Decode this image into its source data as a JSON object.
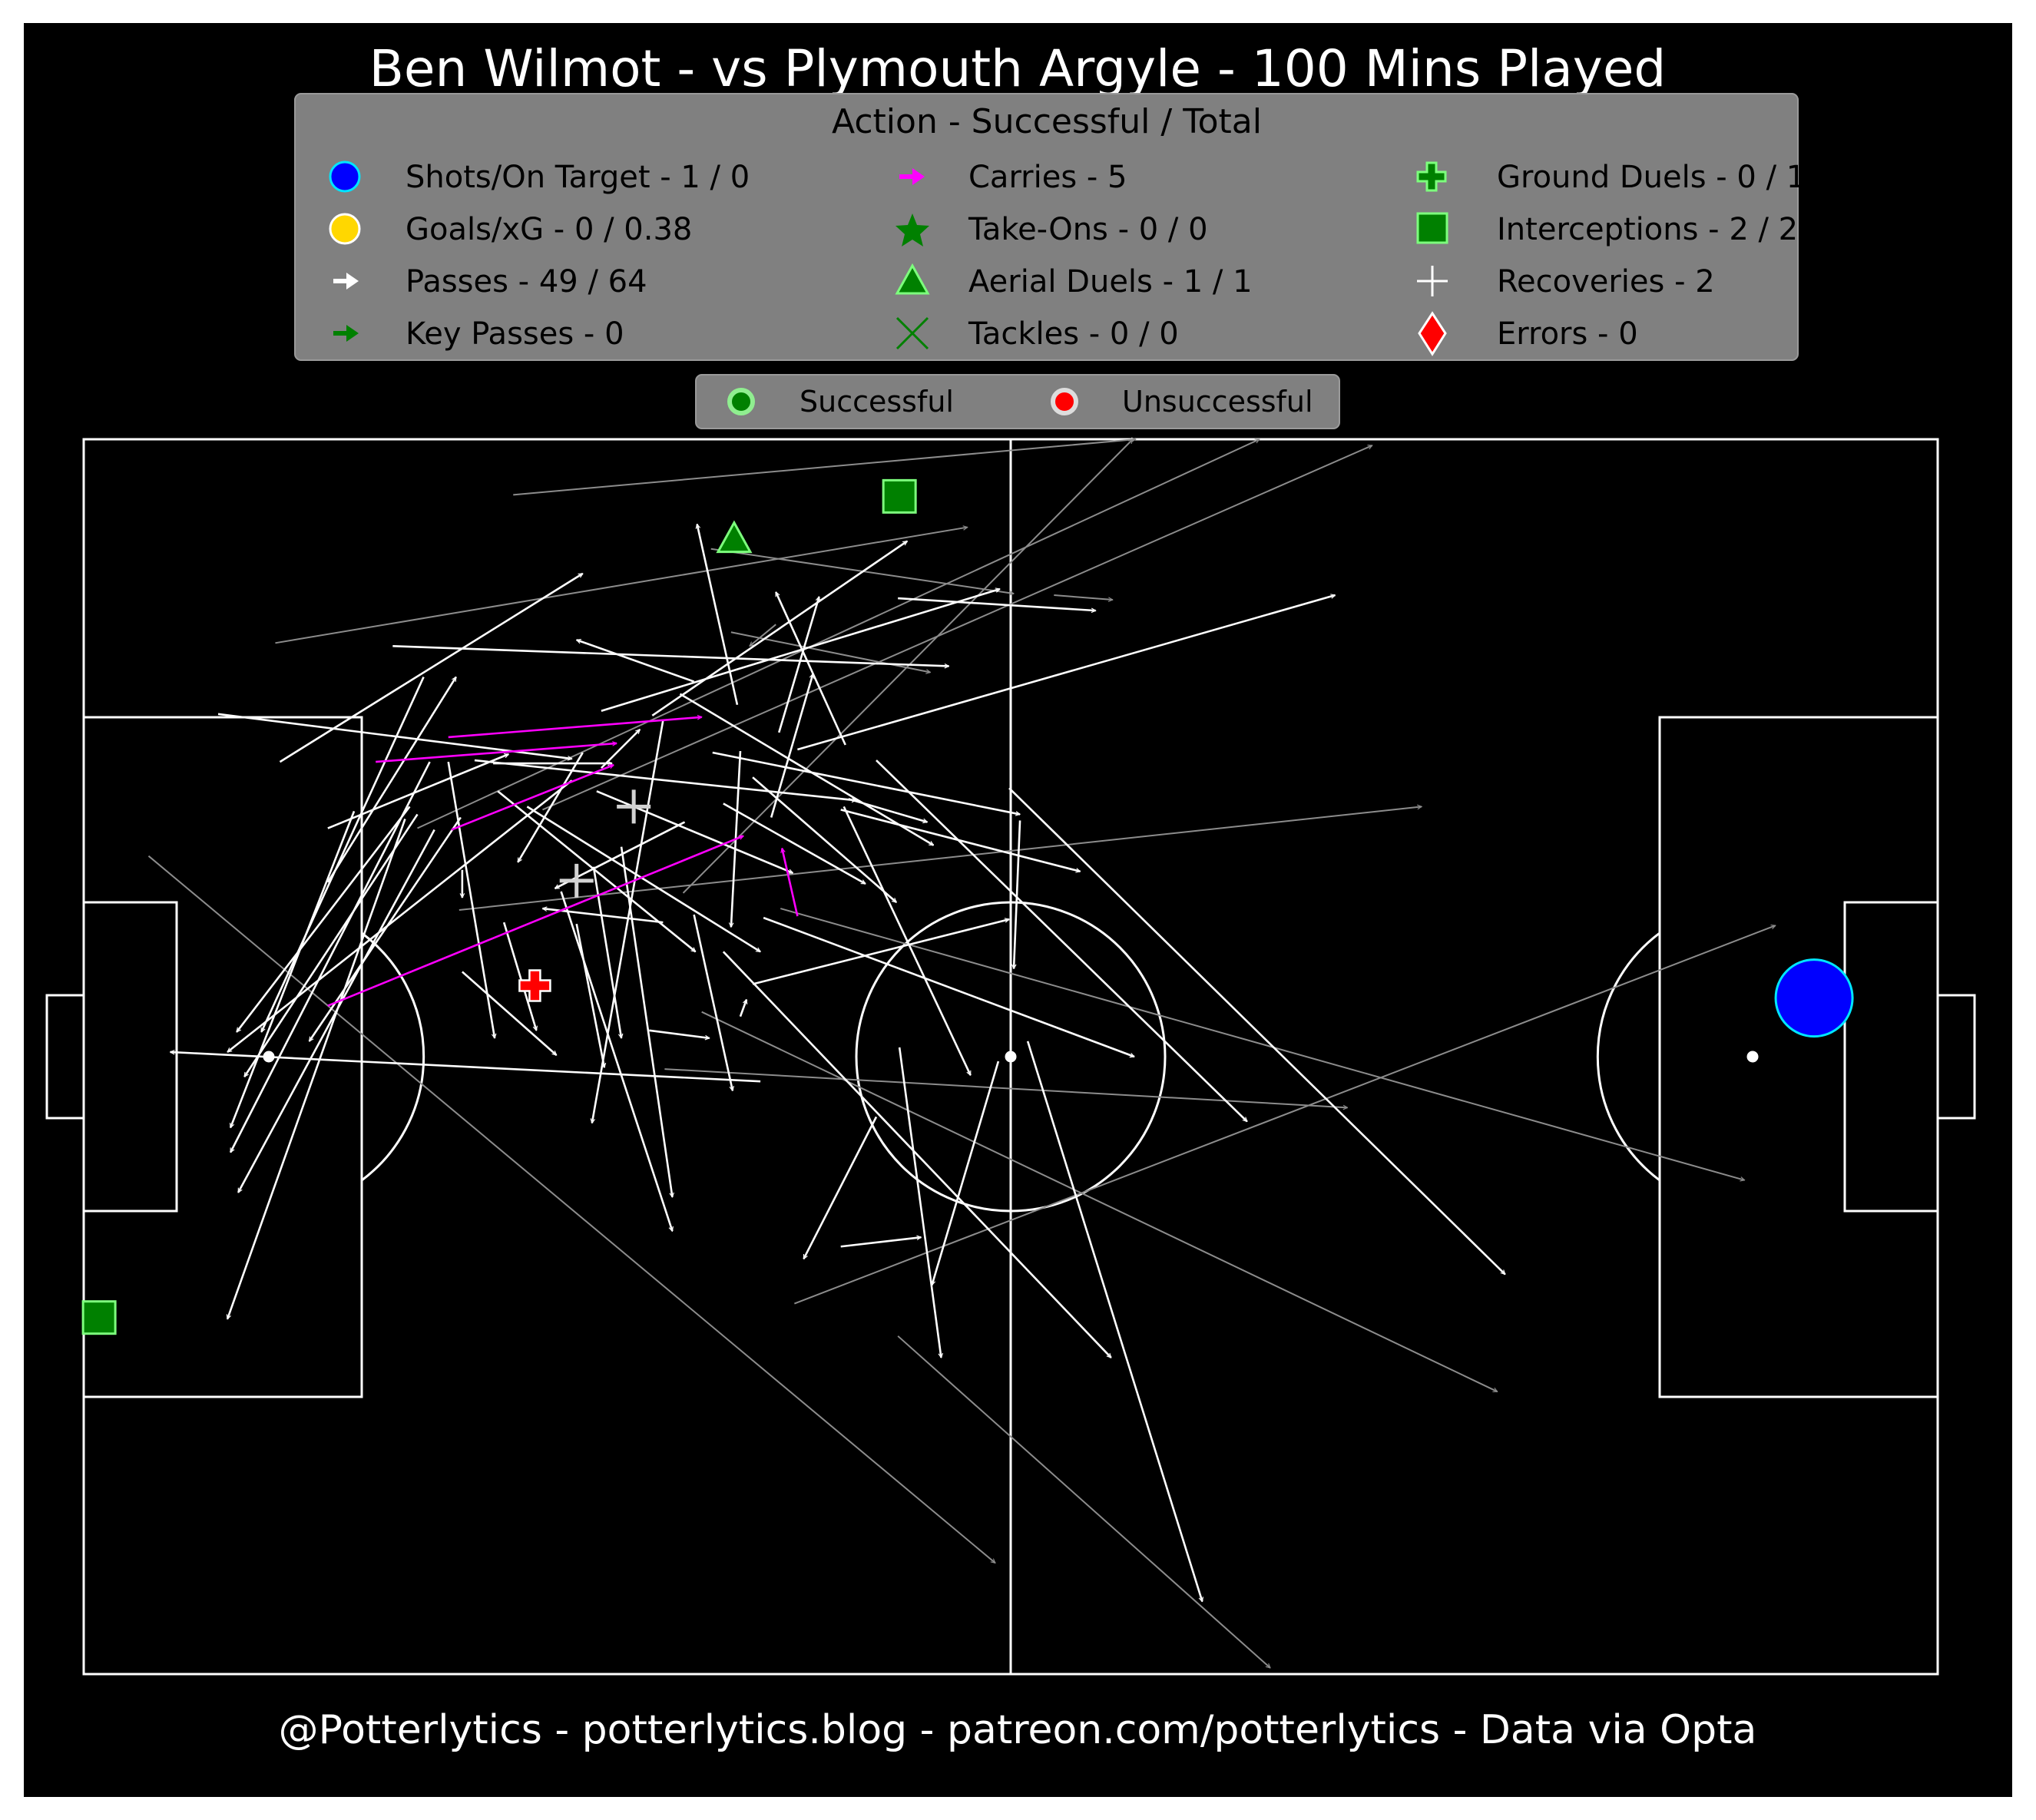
{
  "title": "Ben Wilmot - vs Plymouth Argyle - 100 Mins Played",
  "footer": "@Potterlytics - potterlytics.blog - patreon.com/potterlytics - Data via Opta",
  "legend": {
    "title": "Action - Successful / Total",
    "items": [
      {
        "label": "Shots/On Target - 1 / 0",
        "icon": "shot-marker"
      },
      {
        "label": "Goals/xG - 0 / 0.38",
        "icon": "goal-marker"
      },
      {
        "label": "Passes - 49 / 64",
        "icon": "pass-arrow"
      },
      {
        "label": "Key Passes - 0",
        "icon": "key-pass-arrow"
      },
      {
        "label": "Carries - 5",
        "icon": "carry-arrow"
      },
      {
        "label": "Take-Ons - 0 / 0",
        "icon": "take-on-star"
      },
      {
        "label": "Aerial Duels - 1 / 1",
        "icon": "aerial-triangle"
      },
      {
        "label": "Tackles - 0 / 0",
        "icon": "tackle-cross"
      },
      {
        "label": "Ground Duels - 0 / 1",
        "icon": "ground-duel-plus"
      },
      {
        "label": "Interceptions - 2 / 2",
        "icon": "interception-square"
      },
      {
        "label": "Recoveries - 2",
        "icon": "recovery-plus"
      },
      {
        "label": "Errors - 0",
        "icon": "error-diamond"
      }
    ]
  },
  "outcome_legend": {
    "successful": "Successful",
    "unsuccessful": "Unsuccessful"
  },
  "colors": {
    "background": "#000000",
    "pitch_lines": "#ffffff",
    "pass_success": "#ffffff",
    "pass_fail": "#8c8c8c",
    "carry": "#ff00ff",
    "shot": "#0000ff",
    "goal": "#ffd700",
    "key_pass": "#008000",
    "defensive": "#008000",
    "recovery": "#d3d3d3",
    "error": "#ff0000",
    "legend_bg": "#808080"
  },
  "chart_data": {
    "type": "scatter",
    "description_units": "pitch coordinates, x 0-120 (attacking left to right), y 0-80 (top touchline = 0)",
    "passes_successful": [
      [
        8.7,
        17.8,
        31.6,
        20.7
      ],
      [
        12.7,
        20.9,
        32.3,
        8.7
      ],
      [
        15.8,
        28.7,
        24.1,
        15.4
      ],
      [
        15.8,
        25.2,
        27.5,
        20.4
      ],
      [
        22.0,
        15.4,
        11.5,
        38.4
      ],
      [
        21.1,
        23.8,
        9.9,
        38.4
      ],
      [
        21.6,
        24.3,
        10.4,
        41.3
      ],
      [
        17.5,
        24.1,
        9.5,
        44.6
      ],
      [
        24.4,
        24.5,
        14.6,
        39.0
      ],
      [
        26.8,
        22.8,
        39.6,
        33.2
      ],
      [
        25.3,
        20.8,
        50.0,
        23.4
      ],
      [
        26.5,
        21.0,
        34.2,
        21.0
      ],
      [
        23.6,
        20.9,
        26.6,
        38.8
      ],
      [
        33.5,
        21.3,
        36.0,
        18.8
      ],
      [
        22.7,
        25.3,
        10.0,
        48.8
      ],
      [
        20.8,
        24.6,
        9.3,
        57.0
      ],
      [
        22.4,
        20.9,
        9.5,
        46.2
      ],
      [
        31.6,
        22.1,
        9.3,
        39.7
      ],
      [
        32.3,
        20.3,
        28.1,
        27.4
      ],
      [
        34.8,
        26.4,
        38.1,
        49.1
      ],
      [
        43.8,
        41.6,
        5.6,
        39.7
      ],
      [
        41.4,
        23.6,
        50.6,
        28.8
      ],
      [
        43.3,
        21.9,
        52.6,
        30.0
      ],
      [
        38.9,
        24.8,
        30.5,
        29.1
      ],
      [
        42.5,
        37.4,
        42.9,
        36.3
      ],
      [
        39.5,
        30.8,
        42.0,
        42.2
      ],
      [
        37.5,
        18.2,
        32.9,
        44.3
      ],
      [
        36.6,
        38.3,
        40.5,
        38.8
      ],
      [
        31.9,
        31.4,
        33.7,
        40.7
      ],
      [
        24.5,
        34.5,
        30.6,
        39.9
      ],
      [
        28.7,
        23.8,
        43.8,
        33.2
      ],
      [
        33.0,
        27.7,
        34.8,
        38.8
      ],
      [
        37.5,
        31.3,
        29.7,
        30.4
      ],
      [
        27.2,
        31.3,
        29.3,
        38.3
      ],
      [
        30.9,
        29.3,
        38.1,
        51.3
      ],
      [
        33.2,
        22.8,
        45.9,
        28.1
      ],
      [
        45.0,
        19.0,
        47.6,
        10.2
      ],
      [
        42.3,
        17.2,
        39.7,
        5.5
      ],
      [
        49.3,
        19.8,
        44.8,
        9.9
      ],
      [
        49.5,
        23.3,
        54.6,
        24.8
      ],
      [
        44.5,
        24.5,
        47.2,
        15.2
      ],
      [
        42.5,
        20.2,
        41.9,
        31.6
      ],
      [
        49.0,
        24.0,
        64.5,
        28.0
      ],
      [
        51.3,
        43.9,
        46.6,
        53.1
      ],
      [
        52.8,
        39.4,
        55.5,
        59.5
      ],
      [
        49.2,
        23.8,
        57.4,
        41.2
      ],
      [
        51.3,
        20.8,
        75.3,
        44.2
      ],
      [
        59.2,
        40.3,
        54.9,
        54.8
      ],
      [
        61.1,
        39.0,
        72.4,
        75.3
      ],
      [
        38.6,
        16.5,
        55.0,
        26.3
      ],
      [
        59.9,
        22.6,
        92.0,
        54.1
      ],
      [
        43.3,
        35.3,
        59.9,
        31.1
      ],
      [
        36.8,
        17.9,
        53.3,
        6.6
      ],
      [
        46.2,
        20.1,
        81.0,
        10.1
      ],
      [
        33.5,
        17.6,
        59.3,
        9.7
      ],
      [
        41.4,
        33.2,
        66.5,
        59.5
      ],
      [
        52.7,
        10.3,
        65.5,
        11.1
      ],
      [
        39.5,
        15.7,
        31.9,
        13.0
      ],
      [
        20.0,
        13.4,
        56.0,
        14.7
      ],
      [
        24.5,
        27.9,
        24.5,
        29.7
      ],
      [
        49.0,
        52.3,
        54.2,
        51.7
      ],
      [
        60.6,
        24.7,
        60.2,
        34.3
      ],
      [
        40.7,
        20.3,
        60.6,
        24.3
      ],
      [
        44.0,
        31.0,
        68.0,
        40.0
      ]
    ],
    "passes_unsuccessful": [
      [
        27.8,
        3.6,
        68.1,
        0.0
      ],
      [
        12.4,
        13.2,
        57.2,
        5.7
      ],
      [
        40.6,
        7.1,
        60.2,
        10.0
      ],
      [
        41.9,
        12.5,
        54.8,
        15.1
      ],
      [
        21.6,
        25.2,
        76.1,
        0.0
      ],
      [
        29.7,
        24.0,
        83.4,
        0.4
      ],
      [
        24.3,
        30.5,
        86.6,
        23.8
      ],
      [
        38.8,
        29.4,
        67.9,
        0.0
      ],
      [
        4.2,
        27.0,
        59.0,
        72.8
      ],
      [
        37.6,
        40.8,
        81.8,
        43.3
      ],
      [
        40.0,
        37.1,
        91.5,
        61.7
      ],
      [
        45.1,
        30.4,
        107.5,
        48.0
      ],
      [
        46.0,
        56.0,
        109.5,
        31.5
      ],
      [
        52.7,
        58.1,
        76.8,
        79.6
      ],
      [
        62.8,
        10.1,
        66.6,
        10.4
      ],
      [
        44.8,
        12.0,
        43.1,
        13.4
      ]
    ],
    "carries": [
      [
        18.9,
        20.9,
        34.5,
        19.7
      ],
      [
        23.6,
        19.3,
        40.0,
        18.0
      ],
      [
        23.8,
        25.3,
        34.3,
        21.1
      ],
      [
        15.8,
        36.7,
        42.7,
        25.7
      ],
      [
        46.2,
        30.9,
        45.2,
        26.5
      ]
    ],
    "shots": [
      {
        "x": 112.0,
        "y": 36.2,
        "outcome": "off target",
        "xg": 0.38
      }
    ],
    "aerial_duels": [
      {
        "x": 42.1,
        "y": 6.5,
        "successful": true
      }
    ],
    "interceptions": [
      {
        "x": 52.8,
        "y": 3.7,
        "successful": true
      },
      {
        "x": 1.0,
        "y": 56.9,
        "successful": true
      }
    ],
    "recoveries": [
      {
        "x": 35.6,
        "y": 23.8
      },
      {
        "x": 31.9,
        "y": 28.6
      }
    ],
    "ground_duels": [
      {
        "x": 29.2,
        "y": 35.4,
        "successful": false
      }
    ]
  }
}
